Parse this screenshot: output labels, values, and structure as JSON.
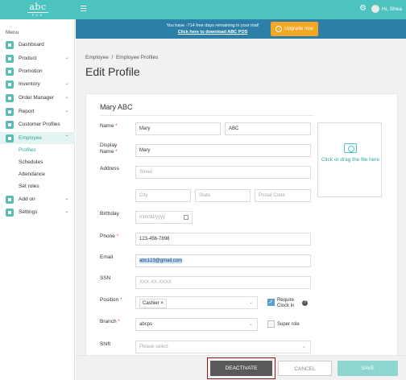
{
  "header": {
    "logo_top": "abc",
    "logo_bottom": "POS",
    "user_greeting": "Hi, Shea"
  },
  "banner": {
    "trial_text": "You have -714 free days remaining in your trial!",
    "download_link": "Click here to download ABC POS",
    "upgrade_label": "Upgrade now"
  },
  "sidebar": {
    "menu_title": "Menu",
    "items": [
      {
        "label": "Dashboard"
      },
      {
        "label": "Product"
      },
      {
        "label": "Promotion"
      },
      {
        "label": "Inventory"
      },
      {
        "label": "Order Manager"
      },
      {
        "label": "Report"
      },
      {
        "label": "Customer Profiles"
      },
      {
        "label": "Employee"
      },
      {
        "label": "Add on"
      },
      {
        "label": "Settings"
      }
    ],
    "employee_sub": [
      "Profiles",
      "Schedules",
      "Attendance",
      "Set roles"
    ]
  },
  "breadcrumb": {
    "root": "Employee",
    "separator": "/",
    "current": "Employee Profiles"
  },
  "page_title": "Edit Profile",
  "form": {
    "card_title": "Mary ABC",
    "name_label": "Name",
    "first_name": "Mary",
    "last_name": "ABC",
    "display_name_label_1": "Display",
    "display_name_label_2": "Name",
    "display_name": "Mary",
    "address_label": "Address",
    "street_placeholder": "Street",
    "city_placeholder": "City",
    "state_placeholder": "State",
    "postal_placeholder": "Postal Code",
    "birthday_label": "Birthday",
    "birthday_placeholder": "mm/dd/yyyy",
    "phone_label": "Phone",
    "phone_value": "123-456-7898",
    "email_label": "Email",
    "email_value": "abc123@gmail.com",
    "ssn_label": "SSN",
    "ssn_placeholder": "XXX-XX-XXXX",
    "position_label": "Position",
    "position_tag": "Cashier",
    "require_clockin_1": "Require",
    "require_clockin_2": "Clock in",
    "require_clockin_checked": true,
    "branch_label": "Branch",
    "branch_value": "abcps",
    "super_role_label": "Super role",
    "shift_label": "Shift",
    "shift_placeholder": "Please select",
    "upload_text": "Click or drag the file here"
  },
  "footer": {
    "deactivate_label": "DEACTIVATE",
    "cancel_label": "CANCEL",
    "save_label": "SAVE"
  },
  "colors": {
    "topbar": "#4cc3bf",
    "banner": "#2c7fa6",
    "upgrade": "#f5a623",
    "accent": "#2fa6a0"
  }
}
